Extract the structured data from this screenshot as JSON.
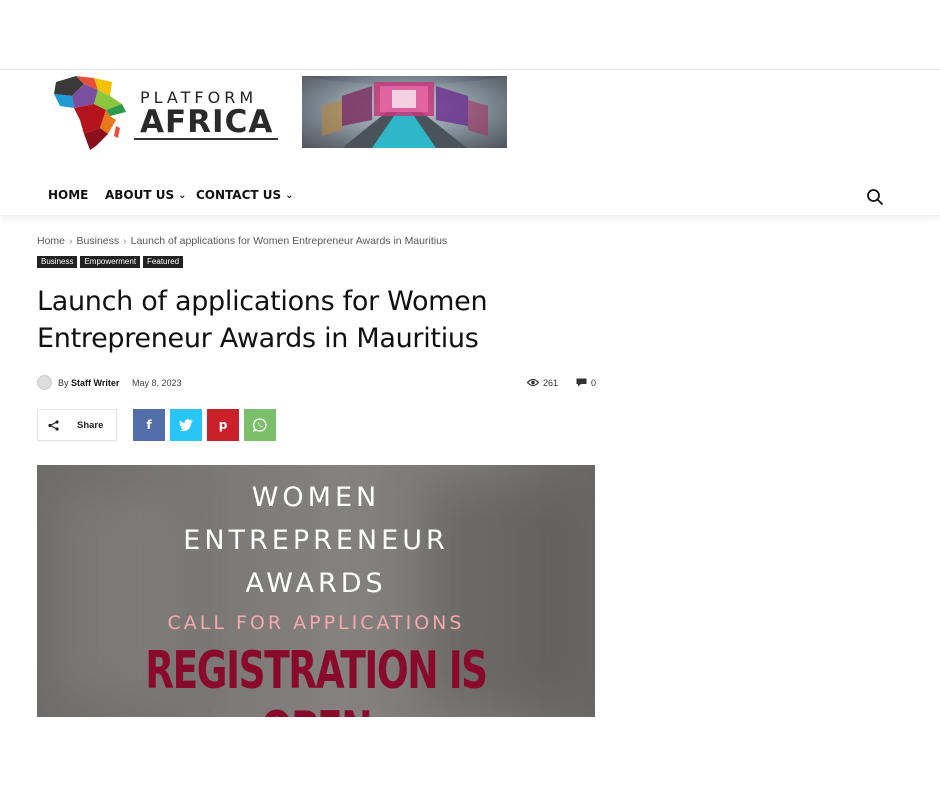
{
  "site": {
    "logo_top": "PLATFORM",
    "logo_main": "AFRICA"
  },
  "nav": {
    "items": [
      {
        "label": "HOME",
        "has_dropdown": false
      },
      {
        "label": "ABOUT US",
        "has_dropdown": true
      },
      {
        "label": "CONTACT US",
        "has_dropdown": true
      }
    ],
    "search_icon": "search-icon"
  },
  "breadcrumb": {
    "home": "Home",
    "category": "Business",
    "current": "Launch of applications for Women Entrepreneur Awards in Mauritius",
    "separator": "›"
  },
  "tags": [
    "Business",
    "Empowerment",
    "Featured"
  ],
  "article": {
    "title": "Launch of applications for Women Entrepreneur Awards in Mauritius",
    "by_prefix": "By",
    "author": "Staff Writer",
    "date": "May 8, 2023",
    "views": "261",
    "comments": "0"
  },
  "share": {
    "label": "Share",
    "buttons": [
      "facebook",
      "twitter",
      "pinterest",
      "whatsapp"
    ]
  },
  "hero": {
    "line1": "WOMEN",
    "line2": "ENTREPRENEUR",
    "line3": "AWARDS",
    "line4": "CALL FOR APPLICATIONS",
    "line5": "REGISTRATION IS OPEN"
  },
  "colors": {
    "facebook": "#516eab",
    "twitter": "#29c5f6",
    "pinterest": "#ca212a",
    "whatsapp": "#7bbf6a",
    "hero_pink": "#f3a9ac",
    "hero_red": "#8a0a2b"
  }
}
